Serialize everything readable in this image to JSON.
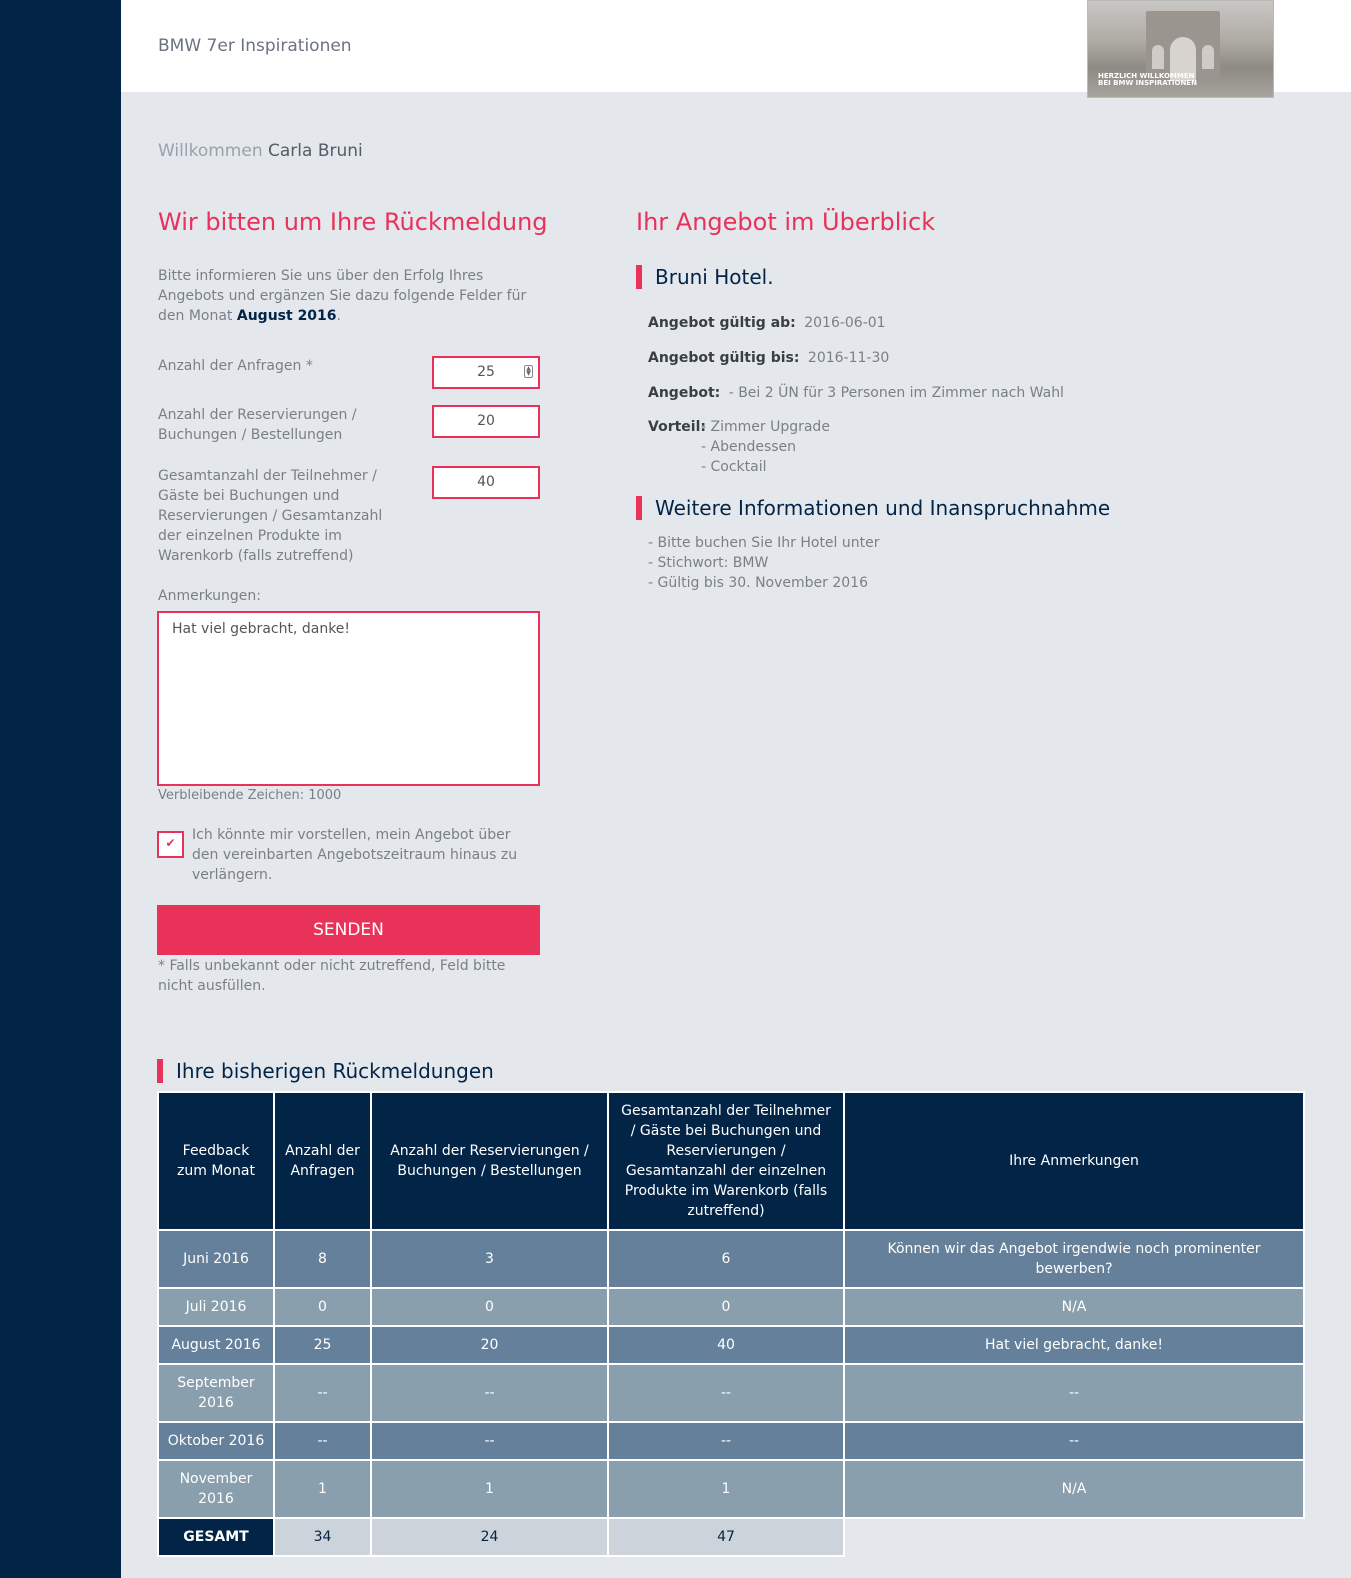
{
  "header": {
    "title": "BMW 7er Inspirationen",
    "banner_line1": "HERZLICH WILLKOMMEN",
    "banner_line2": "BEI BMW INSPIRATIONEN"
  },
  "welcome": {
    "prefix": "Willkommen",
    "name": "Carla Bruni"
  },
  "feedback_form": {
    "heading": "Wir bitten um Ihre Rückmeldung",
    "intro": "Bitte informieren Sie uns über den Erfolg Ihres Angebots und ergänzen Sie dazu folgende Felder für den Monat",
    "month": "August 2016",
    "fields": [
      {
        "label": "Anzahl der Anfragen *",
        "value": "25"
      },
      {
        "label": "Anzahl der Reservierungen / Buchungen / Bestellungen",
        "value": "20"
      },
      {
        "label": "Gesamtanzahl der Teilnehmer / Gäste bei Buchungen und Reservierungen / Gesamtanzahl der einzelnen Produkte im Warenkorb (falls zutreffend)",
        "value": "40"
      }
    ],
    "remarks_label": "Anmerkungen:",
    "remarks_value": "Hat viel gebracht, danke!",
    "remaining_chars": "Verbleibende Zeichen: 1000",
    "extend_checked": true,
    "extend_label": "Ich könnte mir vorstellen, mein Angebot über den vereinbarten Angebotszeitraum hinaus zu verlängern.",
    "send_label": "SENDEN",
    "footnote": "* Falls unbekannt oder nicht zutreffend, Feld bitte nicht ausfüllen."
  },
  "overview": {
    "heading": "Ihr Angebot im Überblick",
    "hotel": "Bruni Hotel.",
    "valid_from_label": "Angebot gültig ab:",
    "valid_from": "2016-06-01",
    "valid_to_label": "Angebot gültig bis:",
    "valid_to": "2016-11-30",
    "offer_label": "Angebot:",
    "offer": "- Bei 2 ÜN für 3 Personen im Zimmer nach Wahl",
    "benefit_label": "Vorteil:",
    "benefits": [
      "- Zimmer Upgrade",
      "- Abendessen",
      "- Cocktail"
    ],
    "more_heading": "Weitere Informationen und Inanspruchnahme",
    "more_info": [
      "- Bitte buchen Sie Ihr Hotel unter",
      "- Stichwort: BMW",
      "- Gültig bis 30. November 2016"
    ]
  },
  "history": {
    "heading": "Ihre bisherigen Rückmeldungen",
    "columns": [
      "Feedback zum Monat",
      "Anzahl der Anfragen",
      "Anzahl der Reservierungen / Buchungen / Bestellungen",
      "Gesamtanzahl der Teilnehmer / Gäste bei Buchungen und Reservierungen / Gesamtanzahl der einzelnen Produkte im Warenkorb (falls zutreffend)",
      "Ihre Anmerkungen"
    ],
    "rows": [
      [
        "Juni 2016",
        "8",
        "3",
        "6",
        "Können wir das Angebot irgendwie noch prominenter bewerben?"
      ],
      [
        "Juli 2016",
        "0",
        "0",
        "0",
        "N/A"
      ],
      [
        "August 2016",
        "25",
        "20",
        "40",
        "Hat viel gebracht, danke!"
      ],
      [
        "September 2016",
        "--",
        "--",
        "--",
        "--"
      ],
      [
        "Oktober 2016",
        "--",
        "--",
        "--",
        "--"
      ],
      [
        "November 2016",
        "1",
        "1",
        "1",
        "N/A"
      ]
    ],
    "total": [
      "GESAMT",
      "34",
      "24",
      "47"
    ]
  }
}
